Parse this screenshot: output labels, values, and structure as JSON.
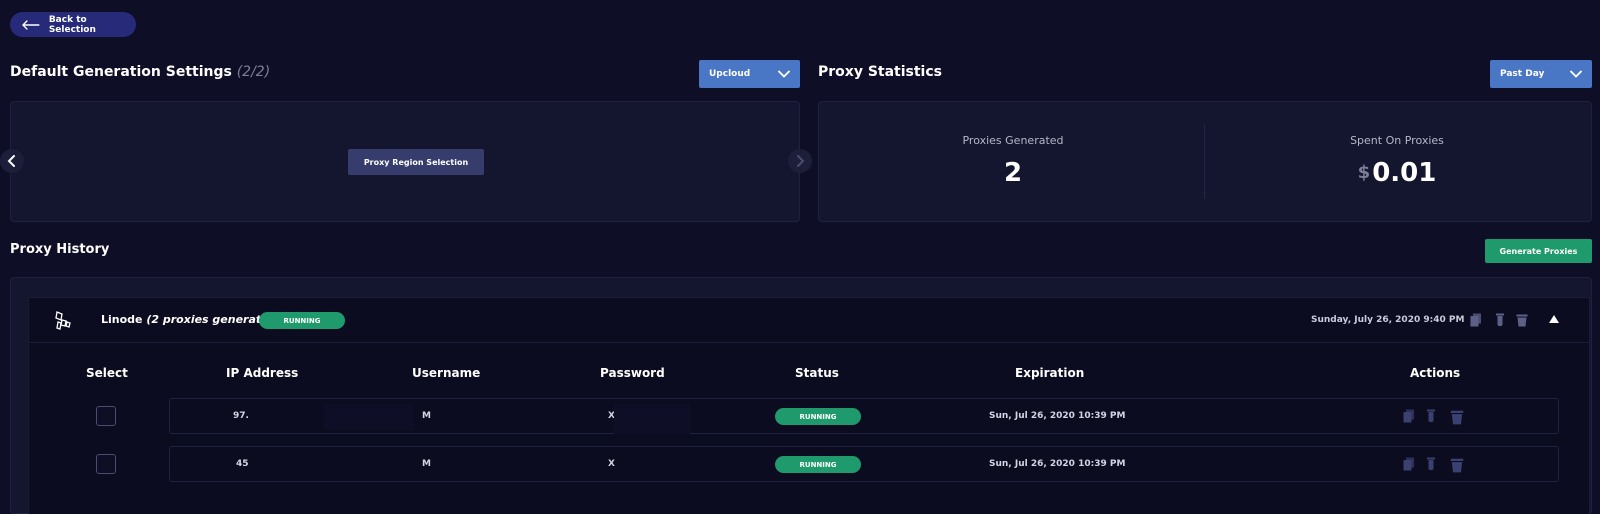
{
  "header": {
    "back_label": "Back to Selection"
  },
  "generation": {
    "title": "Default Generation Settings",
    "counter": "(2/2)",
    "provider_dropdown": "Upcloud",
    "region_button": "Proxy Region Selection"
  },
  "statistics": {
    "title": "Proxy Statistics",
    "period_dropdown": "Past Day",
    "generated_label": "Proxies Generated",
    "generated_value": "2",
    "spent_label": "Spent On Proxies",
    "spent_currency": "$",
    "spent_value": "0.01"
  },
  "history": {
    "title": "Proxy History",
    "generate_button": "Generate Proxies",
    "group": {
      "provider": "Linode",
      "count_text": "(2 proxies generated)",
      "status": "RUNNING",
      "timestamp": "Sunday, July 26, 2020 9:40 PM"
    },
    "columns": [
      "Select",
      "IP Address",
      "Username",
      "Password",
      "Status",
      "Expiration",
      "Actions"
    ],
    "rows": [
      {
        "ip": "97.",
        "username": "M",
        "password": "X",
        "status": "RUNNING",
        "expiration": "Sun, Jul 26, 2020 10:39 PM"
      },
      {
        "ip": "45",
        "username": "M",
        "password": "X",
        "status": "RUNNING",
        "expiration": "Sun, Jul 26, 2020 10:39 PM"
      }
    ]
  },
  "icons": {
    "back": "arrow-left-icon",
    "dropdown": "chevron-down-icon",
    "prev": "chevron-left-icon",
    "next": "chevron-right-icon",
    "provider": "linode-logo-icon",
    "copy": "copy-icon",
    "test": "test-tube-icon",
    "delete": "trash-icon",
    "collapse": "triangle-up-icon"
  },
  "colors": {
    "background": "#0e0f26",
    "panel": "#14152e",
    "accent_blue": "#4a76c6",
    "back_button": "#262a78",
    "running_green": "#1f9a6c"
  }
}
